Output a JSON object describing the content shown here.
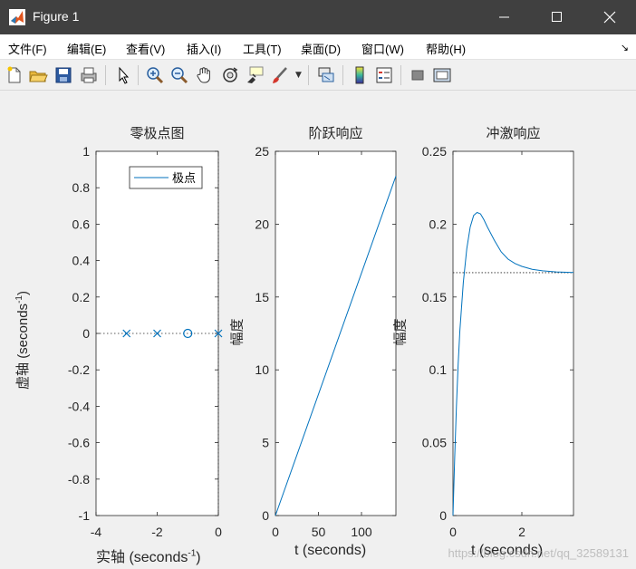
{
  "window": {
    "title": "Figure 1"
  },
  "menu": [
    {
      "label": "文件(F)"
    },
    {
      "label": "编辑(E)"
    },
    {
      "label": "查看(V)"
    },
    {
      "label": "插入(I)"
    },
    {
      "label": "工具(T)"
    },
    {
      "label": "桌面(D)"
    },
    {
      "label": "窗口(W)"
    },
    {
      "label": "帮助(H)"
    }
  ],
  "toolbar": {
    "icons": [
      "new-figure-icon",
      "open-file-icon",
      "save-icon",
      "print-icon",
      "pointer-icon",
      "zoom-in-icon",
      "zoom-out-icon",
      "pan-icon",
      "rotate-3d-icon",
      "data-cursor-icon",
      "brush-icon",
      "link-plot-icon",
      "colorbar-icon",
      "legend-icon",
      "hide-plot-tools-icon",
      "show-plot-tools-icon"
    ]
  },
  "chart_data": [
    {
      "type": "scatter",
      "title": "零极点图",
      "xlabel": "实轴 (seconds",
      "xlabel_sup": "-1",
      "xlabel_close": ")",
      "ylabel": "虚轴 (seconds",
      "ylabel_sup": "-1",
      "ylabel_close": ")",
      "xlim": [
        -4,
        0
      ],
      "ylim": [
        -1,
        1
      ],
      "xticks": [
        "-4",
        "-2",
        "0"
      ],
      "yticks": [
        "-1",
        "-0.8",
        "-0.6",
        "-0.4",
        "-0.2",
        "0",
        "0.2",
        "0.4",
        "0.6",
        "0.8",
        "1"
      ],
      "poles": [
        {
          "x": -3,
          "y": 0
        },
        {
          "x": -2,
          "y": 0
        },
        {
          "x": 0,
          "y": 0
        }
      ],
      "zeros": [
        {
          "x": -1,
          "y": 0
        }
      ],
      "legend": {
        "entries": [
          "极点"
        ],
        "location": "top-right"
      },
      "color": "#0072bd"
    },
    {
      "type": "line",
      "title": "阶跃响应",
      "xlabel": "t (seconds)",
      "ylabel": "幅度",
      "xlim": [
        0,
        140
      ],
      "ylim": [
        0,
        25
      ],
      "xticks": [
        "0",
        "50",
        "100"
      ],
      "yticks": [
        "0",
        "5",
        "10",
        "15",
        "20",
        "25"
      ],
      "x": [
        0,
        140
      ],
      "y": [
        0,
        23.3
      ],
      "color": "#0072bd"
    },
    {
      "type": "line",
      "title": "冲激响应",
      "xlabel": "t (seconds)",
      "ylabel": "幅度",
      "xlim": [
        0,
        3.5
      ],
      "ylim": [
        0,
        0.25
      ],
      "xticks": [
        "0",
        "2"
      ],
      "yticks": [
        "0",
        "0.05",
        "0.1",
        "0.15",
        "0.2",
        "0.25"
      ],
      "x": [
        0,
        0.05,
        0.1,
        0.15,
        0.2,
        0.3,
        0.4,
        0.5,
        0.6,
        0.7,
        0.8,
        0.9,
        1.0,
        1.2,
        1.4,
        1.6,
        1.8,
        2.0,
        2.3,
        2.6,
        3.0,
        3.5
      ],
      "y": [
        0,
        0.04,
        0.075,
        0.104,
        0.127,
        0.16,
        0.183,
        0.198,
        0.206,
        0.208,
        0.207,
        0.203,
        0.198,
        0.189,
        0.181,
        0.176,
        0.173,
        0.171,
        0.169,
        0.168,
        0.1672,
        0.1668
      ],
      "steady_state": 0.1667,
      "color": "#0072bd"
    }
  ],
  "watermark": "https://blog.csdn.net/qq_32589131"
}
